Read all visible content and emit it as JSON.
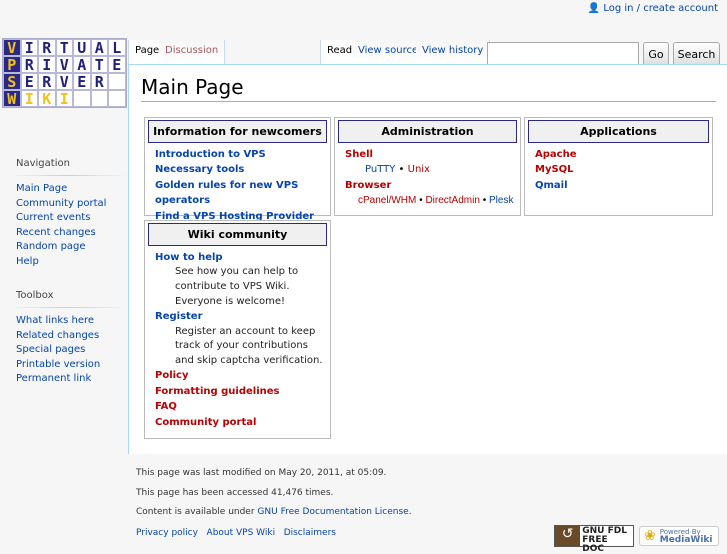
{
  "personal": {
    "icon": "user-icon",
    "login": "Log in / create account"
  },
  "logo": {
    "rows": [
      "VIRTUAL",
      "PRIVATE",
      "SERVER ",
      "WIKI   "
    ],
    "text": "VPS Wiki"
  },
  "tabs": {
    "page": "Page",
    "discussion": "Discussion",
    "read": "Read",
    "view_source": "View source",
    "view_history": "View history"
  },
  "search": {
    "value": "",
    "go": "Go",
    "search": "Search"
  },
  "navigation": {
    "title": "Navigation",
    "items": [
      "Main Page",
      "Community portal",
      "Current events",
      "Recent changes",
      "Random page",
      "Help"
    ]
  },
  "toolbox": {
    "title": "Toolbox",
    "items": [
      "What links here",
      "Related changes",
      "Special pages",
      "Printable version",
      "Permanent link"
    ]
  },
  "title": "Main Page",
  "newcomers": {
    "title": "Information for newcomers",
    "items": [
      "Introduction to VPS",
      "Necessary tools",
      "Golden rules for new VPS operators",
      "Find a VPS Hosting Provider"
    ]
  },
  "administration": {
    "title": "Administration",
    "shell": "Shell",
    "putty": "PuTTY",
    "unix": "Unix",
    "browser": "Browser",
    "cpanel": "cPanel/WHM",
    "directadmin": "DirectAdmin",
    "plesk": "Plesk",
    "sep": "•"
  },
  "applications": {
    "title": "Applications",
    "apache": "Apache",
    "mysql": "MySQL",
    "qmail": "Qmail"
  },
  "community": {
    "title": "Wiki community",
    "how": "How to help",
    "how_desc": "See how you can help to contribute to VPS Wiki. Everyone is welcome!",
    "register": "Register",
    "register_desc": "Register an account to keep track of your contributions and skip captcha verification.",
    "policy": "Policy",
    "formatting": "Formatting guidelines",
    "faq": "FAQ",
    "portal": "Community portal"
  },
  "footer": {
    "modified": "This page was last modified on May 20, 2011, at 05:09.",
    "accessed": "This page has been accessed 41,476 times.",
    "license_prefix": "Content is available under ",
    "license": "GNU Free Documentation License",
    "license_suffix": ".",
    "privacy": "Privacy policy",
    "about": "About VPS Wiki",
    "disclaimers": "Disclaimers",
    "gnu_badge": "GNU FDL FREE DOC",
    "mw_badge": "Powered By MediaWiki"
  }
}
